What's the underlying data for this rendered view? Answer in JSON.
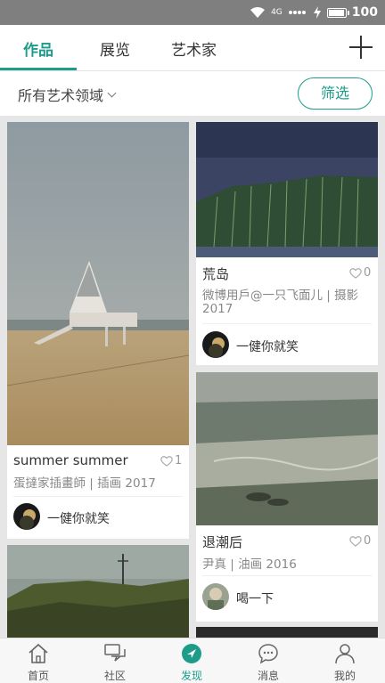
{
  "status_bar": {
    "network": "4G",
    "battery": "100",
    "battery_level": 1.0
  },
  "tabs": [
    {
      "label": "作品",
      "active": true
    },
    {
      "label": "展览",
      "active": false
    },
    {
      "label": "艺术家",
      "active": false
    }
  ],
  "filter": {
    "domain_label": "所有艺术领域",
    "filter_button": "筛选"
  },
  "works_left": [
    {
      "title": "summer summer",
      "likes": "1",
      "meta": "蛋撻家插畫師 | 插画 2017",
      "user": "一健你就笑",
      "image": "seaside-tower-painting"
    },
    {
      "image": "coastal-cliff-painting"
    }
  ],
  "works_right": [
    {
      "title": "荒岛",
      "likes": "0",
      "meta_line1": "微博用戶@一只飞面儿 | 摄影",
      "meta_line2": "2017",
      "user": "一健你就笑",
      "image": "reeds-and-sea-photo"
    },
    {
      "title": "退潮后",
      "likes": "0",
      "meta": "尹真 | 油画 2016",
      "user": "喝一下",
      "image": "low-tide-oil-painting"
    }
  ],
  "bottom_nav": [
    {
      "label": "首页",
      "icon": "home-icon",
      "active": false
    },
    {
      "label": "社区",
      "icon": "community-chat-icon",
      "active": false
    },
    {
      "label": "发现",
      "icon": "discover-compass-icon",
      "active": true
    },
    {
      "label": "消息",
      "icon": "message-bubble-icon",
      "active": false
    },
    {
      "label": "我的",
      "icon": "profile-icon",
      "active": false
    }
  ],
  "colors": {
    "accent": "#1d9c8a",
    "status_bar": "#7f7f7f",
    "background": "#e6e6e6"
  }
}
